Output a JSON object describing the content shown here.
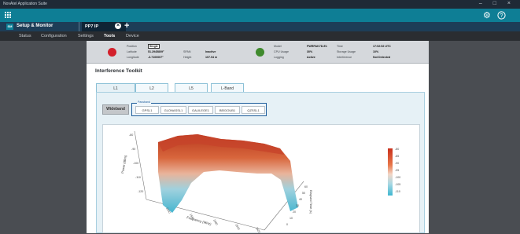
{
  "window": {
    "title": "NovAtel Application Suite",
    "controls": "– □ ×"
  },
  "appbar": {
    "settings_icon": "gear-icon",
    "help_icon": "help-circle-icon"
  },
  "tabbar": {
    "logo": "SM",
    "app_name": "Setup & Monitor",
    "device_tab": "PP7 IP",
    "add_label": "+"
  },
  "nav": [
    "Status",
    "Configuration",
    "Settings",
    "Tools",
    "Device"
  ],
  "nav_active": "Tools",
  "status": {
    "position_label": "Position",
    "position_value": "Single",
    "latitude_label": "Latitude",
    "latitude_value": "51.2945809°",
    "longitude_label": "Longitude",
    "longitude_value": "-3.7100007°",
    "ins_label": "SPAN",
    "ins_value": "Inactive",
    "height_label": "Height",
    "height_value": "107.94 m",
    "model_label": "Model",
    "model_value": "PWRPAK7D-E1",
    "cpu_label": "CPU Usage",
    "cpu_value": "30%",
    "logging_label": "Logging",
    "logging_value": "Active",
    "time_label": "Time",
    "time_value": "17:52:52 UTC",
    "storage_label": "Storage Usage",
    "storage_value": "10%",
    "interference_label": "Interference",
    "interference_value": "Not Detected",
    "position_dot_color": "#d3202b",
    "model_dot_color": "#3f8a2d"
  },
  "toolkit": {
    "title": "Interference Toolkit",
    "tabs": [
      "L1",
      "L2",
      "L5",
      "L-Band"
    ],
    "selected_tab": "L1",
    "wideband_label": "Wideband",
    "passband_legend": "Passband",
    "passband_buttons": [
      "GPSL1",
      "GLONASSL1",
      "GALILEOE1",
      "BEIDOUB1",
      "QZSSL1"
    ]
  },
  "plot": {
    "y_ticks": [
      "-80",
      "-90",
      "-100",
      "-110",
      "-120"
    ],
    "y_axis_label": "Power (dBm)",
    "x_ticks": [
      "1540",
      "1560",
      "1580",
      "1600",
      "1620"
    ],
    "x_axis_label": "Frequency (MHz)",
    "z_ticks": [
      "60",
      "50",
      "40",
      "30",
      "20",
      "10",
      "0"
    ],
    "z_axis_label": "Elapsed Time (s)",
    "colorbar_ticks": [
      "-80",
      "-85",
      "-90",
      "-95",
      "-100",
      "-105",
      "-110"
    ],
    "colorbar_top": "#c9301c",
    "colorbar_bottom": "#3fb7d0"
  }
}
